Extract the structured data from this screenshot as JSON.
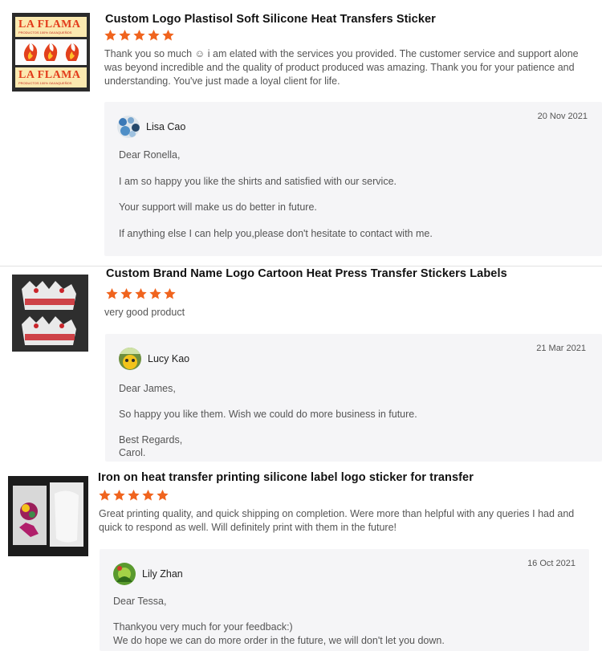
{
  "reviews": [
    {
      "title": "Custom Logo Plastisol Soft Silicone Heat Transfers Sticker",
      "stars": 5,
      "text": "Thank you so much ☺ i am elated with the services you provided. The customer service and support alone was beyond incredible and the quality of product produced was amazing. Thank you for your patience and understanding. You've just made a loyal client for life.",
      "thumb_text": "LA FLAMA",
      "thumb_sub": "PRODUCTOS 100% OAXAQUEÑOS",
      "reply": {
        "date": "20 Nov 2021",
        "seller": "Lisa Cao",
        "lines": [
          "Dear Ronella,",
          "I am so happy you like the shirts and satisfied with our service.",
          "Your support will make us do better in future.",
          "If anything else I can help you,please don't hesitate to contact with me."
        ]
      }
    },
    {
      "title": "Custom Brand Name Logo Cartoon Heat Press Transfer Stickers Labels",
      "stars": 5,
      "text": "very good product",
      "reply": {
        "date": "21 Mar 2021",
        "seller": "Lucy Kao",
        "lines": [
          "Dear James,",
          "So happy you like them. Wish we could do more business in future.",
          "Best Regards,",
          "Carol."
        ]
      }
    },
    {
      "title": "Iron on heat transfer printing silicone label logo sticker for transfer",
      "stars": 5,
      "text": "Great printing quality, and quick shipping on completion. Were more than helpful with any queries I had and quick to respond as well. Will definitely print with them in the future!",
      "reply": {
        "date": "16 Oct 2021",
        "seller": "Lily Zhan",
        "lines": [
          "Dear Tessa,",
          "Thankyou very much for your feedback:)",
          "We do hope we can do more order in the future, we will don't let you down."
        ]
      }
    }
  ],
  "colors": {
    "star": "#f0641e",
    "reply_bg": "#f5f5f7"
  }
}
